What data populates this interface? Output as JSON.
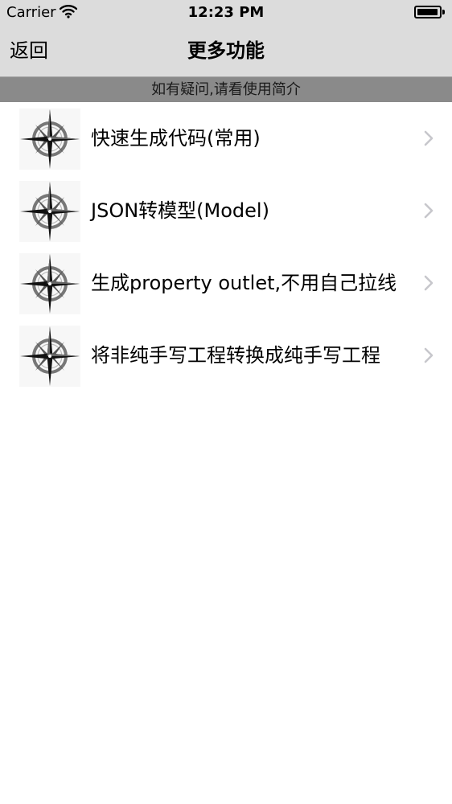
{
  "status_bar": {
    "carrier": "Carrier",
    "time": "12:23 PM",
    "battery_level": 0.95,
    "icons": [
      "wifi-icon",
      "battery-icon"
    ]
  },
  "nav_bar": {
    "back_label": "返回",
    "title": "更多功能"
  },
  "hint": "如有疑问,请看使用简介",
  "list": {
    "icon": "compass-icon",
    "chevron": "chevron-right-icon",
    "items": [
      {
        "label": "快速生成代码(常用)"
      },
      {
        "label": "JSON转模型(Model)"
      },
      {
        "label": "生成property outlet,不用自己拉线"
      },
      {
        "label": "将非纯手写工程转换成纯手写工程"
      }
    ]
  },
  "colors": {
    "bar_background": "#dcdcdc",
    "hint_background": "#8a8a8a",
    "chevron": "#c7c7cc"
  }
}
